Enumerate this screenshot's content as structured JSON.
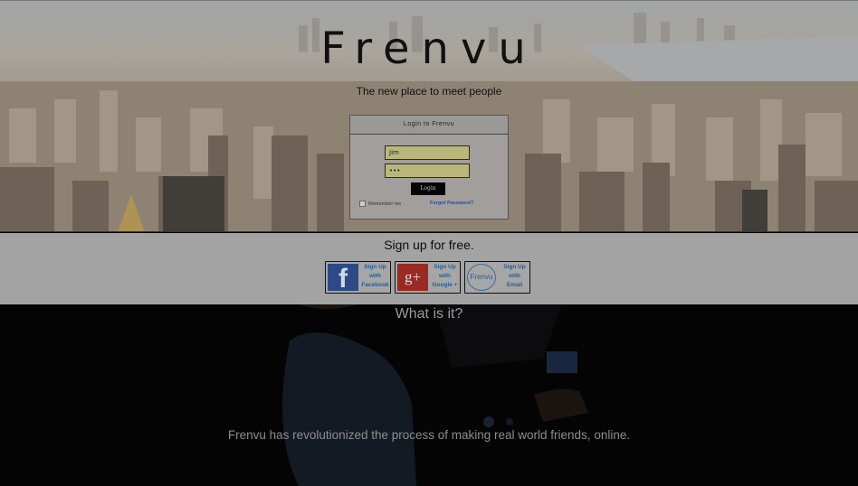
{
  "hero": {
    "title": "Frenvu",
    "tagline": "The new place to meet people"
  },
  "login": {
    "heading": "Login to Frenvu",
    "username_value": "Jim",
    "password_value": "•••",
    "button_label": "Login",
    "remember_label": "Remember me",
    "forgot_label": "Forgot Password?"
  },
  "signup": {
    "title": "Sign up for free.",
    "buttons": [
      {
        "line1": "Sign Up",
        "line2": "with",
        "line3": "Facebook",
        "icon": "facebook-icon",
        "glyph": "f"
      },
      {
        "line1": "Sign Up",
        "line2": "with",
        "line3": "Google +",
        "icon": "google-plus-icon",
        "glyph": "g+"
      },
      {
        "line1": "Sign Up",
        "line2": "with",
        "line3": "Email",
        "icon": "frenvu-logo-icon",
        "glyph": "Frenvu"
      }
    ]
  },
  "about": {
    "title": "What is it?",
    "text": "Frenvu has revolutionized the process of making real world friends, online."
  },
  "colors": {
    "field_bg": "#b9b87a",
    "link_blue": "#1e5f99",
    "facebook": "#2c4a86",
    "google": "#9a2a22"
  }
}
